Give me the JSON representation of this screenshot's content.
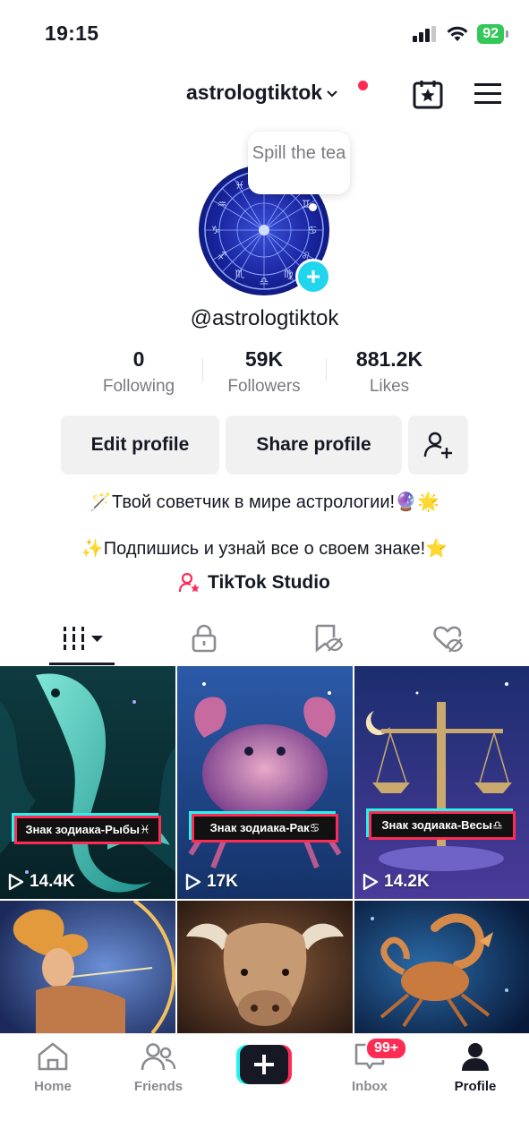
{
  "status_bar": {
    "time": "19:15",
    "battery": "92"
  },
  "header": {
    "username": "astrologtiktok"
  },
  "profile": {
    "bubble_text": "Spill the tea",
    "handle": "@astrologtiktok",
    "stats": [
      {
        "value": "0",
        "label": "Following"
      },
      {
        "value": "59K",
        "label": "Followers"
      },
      {
        "value": "881.2K",
        "label": "Likes"
      }
    ],
    "buttons": {
      "edit": "Edit profile",
      "share": "Share profile"
    },
    "bio_line1": "🪄Твой советчик в мире астрологии!🔮🌟",
    "bio_line2": "✨Подпишись и узнай все о своем знаке!⭐",
    "studio_link": "TikTok Studio"
  },
  "videos": [
    {
      "label": "Знак зодиака-Рыбы♓",
      "views": "14.4K",
      "theme": "pisces"
    },
    {
      "label": "Знак зодиака-Рак♋",
      "views": "17K",
      "theme": "cancer"
    },
    {
      "label": "Знак зодиака-Весы♎",
      "views": "14.2K",
      "theme": "libra"
    },
    {
      "label": "",
      "views": "",
      "theme": "sagittarius"
    },
    {
      "label": "",
      "views": "",
      "theme": "taurus"
    },
    {
      "label": "",
      "views": "",
      "theme": "scorpio"
    }
  ],
  "bottom_nav": {
    "home": "Home",
    "friends": "Friends",
    "inbox": "Inbox",
    "inbox_badge": "99+",
    "profile": "Profile"
  },
  "colors": {
    "accent_red": "#fe2c55",
    "accent_cyan": "#25f4ee",
    "muted": "#7a7b80"
  }
}
